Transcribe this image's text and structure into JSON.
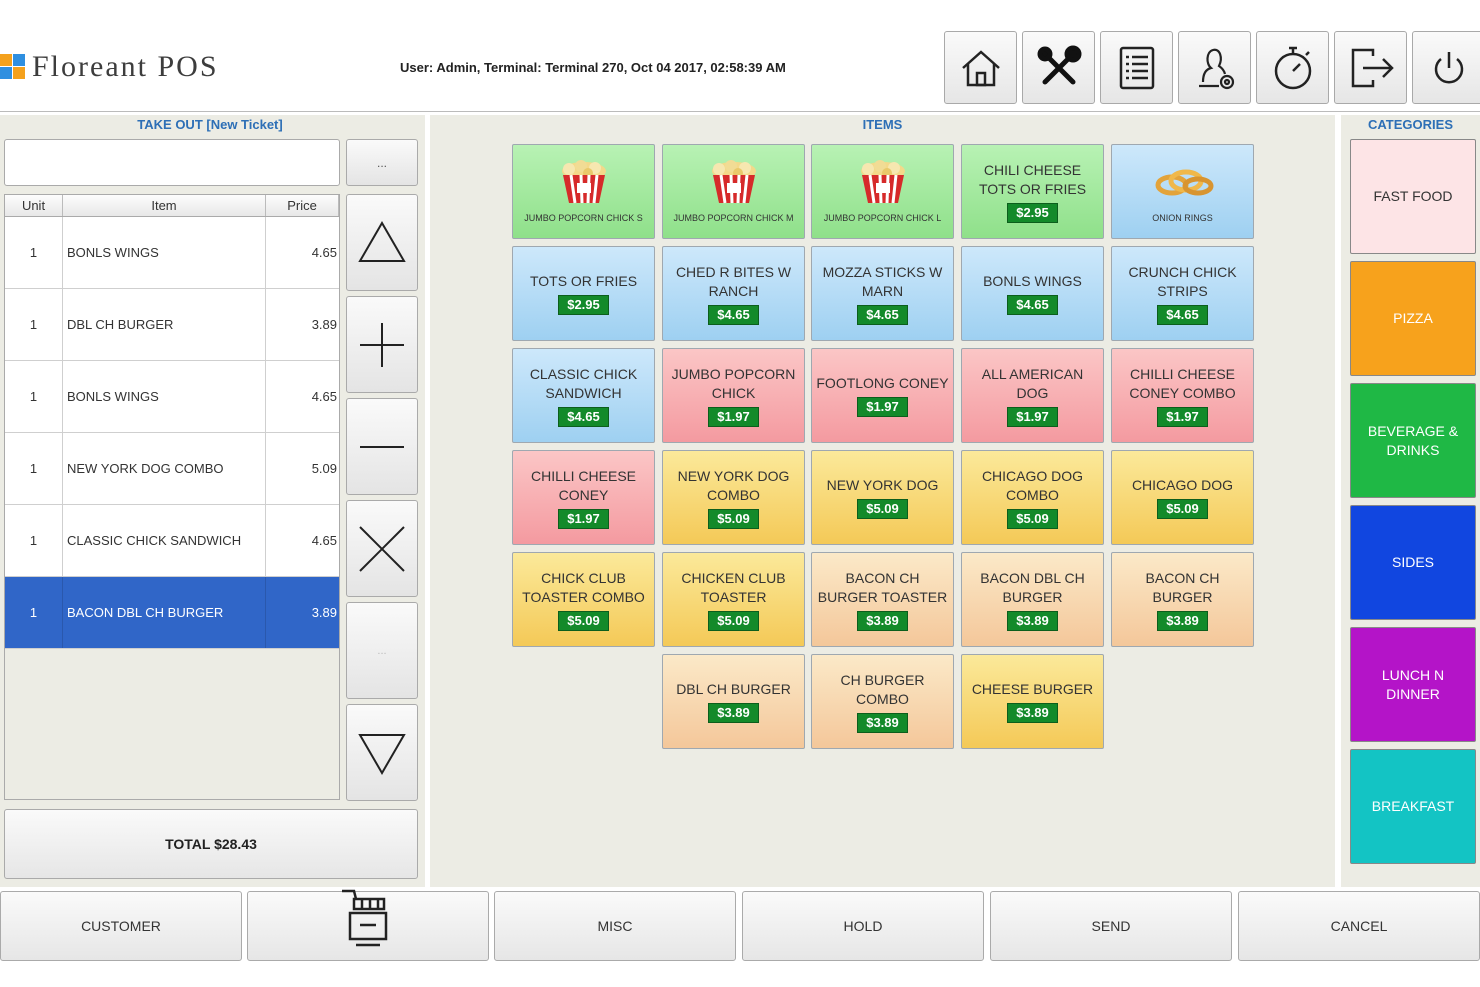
{
  "header": {
    "app_name": "Floreant POS",
    "status_text": "User: Admin, Terminal: Terminal 270, Oct 04 2017, 02:58:39 AM",
    "buttons": [
      "home-icon",
      "tools-icon",
      "list-icon",
      "user-settings-icon",
      "stopwatch-icon",
      "logout-icon",
      "power-icon"
    ]
  },
  "ticket": {
    "title": "TAKE OUT [New Ticket]",
    "dots_label": "...",
    "columns": [
      "Unit",
      "Item",
      "Price"
    ],
    "rows": [
      {
        "unit": "1",
        "item": "BONLS WINGS",
        "price": "4.65"
      },
      {
        "unit": "1",
        "item": "DBL CH BURGER",
        "price": "3.89"
      },
      {
        "unit": "1",
        "item": "BONLS WINGS",
        "price": "4.65"
      },
      {
        "unit": "1",
        "item": "NEW YORK DOG COMBO",
        "price": "5.09"
      },
      {
        "unit": "1",
        "item": "CLASSIC CHICK SANDWICH",
        "price": "4.65"
      },
      {
        "unit": "1",
        "item": "BACON DBL CH BURGER",
        "price": "3.89"
      }
    ],
    "disabled_label": "...",
    "total": "TOTAL $28.43"
  },
  "items": {
    "title": "ITEMS",
    "cells": [
      {
        "name": "JUMBO POPCORN CHICK S",
        "price": "",
        "color": "green",
        "image": "popcorn-icon"
      },
      {
        "name": "JUMBO POPCORN CHICK M",
        "price": "",
        "color": "green",
        "image": "popcorn-icon"
      },
      {
        "name": "JUMBO POPCORN CHICK L",
        "price": "",
        "color": "green",
        "image": "popcorn-icon"
      },
      {
        "name": "CHILI CHEESE TOTS OR FRIES",
        "price": "$2.95",
        "color": "green"
      },
      {
        "name": "ONION RINGS",
        "price": "",
        "color": "blue",
        "image": "onion-rings-icon"
      },
      {
        "name": "TOTS OR FRIES",
        "price": "$2.95",
        "color": "blue"
      },
      {
        "name": "CHED R BITES W RANCH",
        "price": "$4.65",
        "color": "blue"
      },
      {
        "name": "MOZZA STICKS W MARN",
        "price": "$4.65",
        "color": "blue"
      },
      {
        "name": "BONLS WINGS",
        "price": "$4.65",
        "color": "blue"
      },
      {
        "name": "CRUNCH CHICK STRIPS",
        "price": "$4.65",
        "color": "blue"
      },
      {
        "name": "CLASSIC CHICK SANDWICH",
        "price": "$4.65",
        "color": "blue"
      },
      {
        "name": "JUMBO POPCORN CHICK",
        "price": "$1.97",
        "color": "pink"
      },
      {
        "name": "FOOTLONG CONEY",
        "price": "$1.97",
        "color": "pink"
      },
      {
        "name": "ALL AMERICAN DOG",
        "price": "$1.97",
        "color": "pink"
      },
      {
        "name": "CHILLI CHEESE CONEY COMBO",
        "price": "$1.97",
        "color": "pink"
      },
      {
        "name": "CHILLI CHEESE CONEY",
        "price": "$1.97",
        "color": "pink"
      },
      {
        "name": "NEW YORK DOG COMBO",
        "price": "$5.09",
        "color": "yellow"
      },
      {
        "name": "NEW YORK DOG",
        "price": "$5.09",
        "color": "yellow"
      },
      {
        "name": "CHICAGO DOG COMBO",
        "price": "$5.09",
        "color": "yellow"
      },
      {
        "name": "CHICAGO DOG",
        "price": "$5.09",
        "color": "yellow"
      },
      {
        "name": "CHICK CLUB TOASTER COMBO",
        "price": "$5.09",
        "color": "yellow"
      },
      {
        "name": "CHICKEN CLUB TOASTER",
        "price": "$5.09",
        "color": "yellow"
      },
      {
        "name": "BACON CH BURGER TOASTER",
        "price": "$3.89",
        "color": "peach"
      },
      {
        "name": "BACON DBL CH BURGER",
        "price": "$3.89",
        "color": "peach"
      },
      {
        "name": "BACON CH BURGER",
        "price": "$3.89",
        "color": "peach"
      },
      {
        "name": "DBL CH BURGER",
        "price": "$3.89",
        "color": "peach"
      },
      {
        "name": "CH BURGER COMBO",
        "price": "$3.89",
        "color": "peach"
      },
      {
        "name": "CHEESE BURGER",
        "price": "$3.89",
        "color": "yellow"
      }
    ]
  },
  "categories": {
    "title": "CATEGORIES",
    "list": [
      {
        "label": "FAST FOOD",
        "bg": "#fde4e6",
        "fg": "#333333"
      },
      {
        "label": "PIZZA",
        "bg": "#f7a21c",
        "fg": "#ffffff"
      },
      {
        "label": "BEVERAGE & DRINKS",
        "bg": "#1fb845",
        "fg": "#ffffff"
      },
      {
        "label": "SIDES",
        "bg": "#1146e0",
        "fg": "#ffffff"
      },
      {
        "label": "LUNCH N DINNER",
        "bg": "#b414c8",
        "fg": "#ffffff"
      },
      {
        "label": "BREAKFAST",
        "bg": "#13c4c4",
        "fg": "#ffffff"
      }
    ]
  },
  "bottom": {
    "customer": "CUSTOMER",
    "cooking": "cooking-pot-icon",
    "misc": "MISC",
    "hold": "HOLD",
    "send": "SEND",
    "cancel": "CANCEL"
  }
}
